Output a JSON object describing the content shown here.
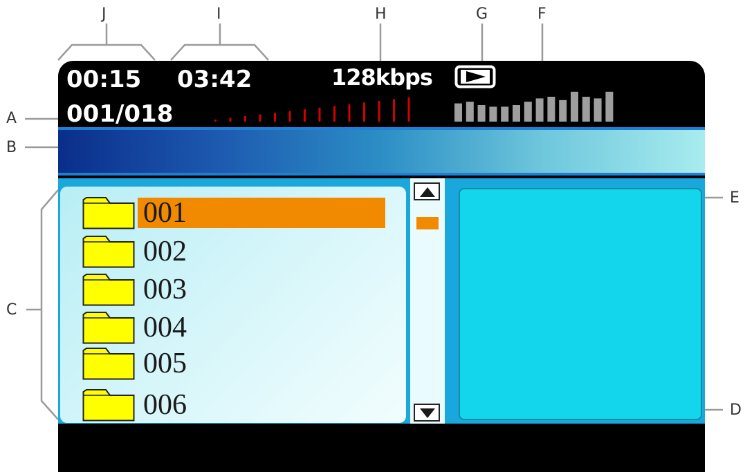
{
  "callouts": {
    "A": "A",
    "B": "B",
    "C": "C",
    "D": "D",
    "E": "E",
    "F": "F",
    "G": "G",
    "H": "H",
    "I": "I",
    "J": "J"
  },
  "status": {
    "elapsed_time": "00:15",
    "total_time": "03:42",
    "bitrate": "128kbps",
    "track_counter": "001/018",
    "play_state_icon": "play-icon",
    "volume_segments": 14,
    "equalizer_levels": [
      0.55,
      0.6,
      0.5,
      0.45,
      0.45,
      0.5,
      0.6,
      0.7,
      0.75,
      0.65,
      0.9,
      0.75,
      0.7,
      0.9
    ]
  },
  "folders": [
    {
      "label": "001",
      "selected": true
    },
    {
      "label": "002",
      "selected": false
    },
    {
      "label": "003",
      "selected": false
    },
    {
      "label": "004",
      "selected": false
    },
    {
      "label": "005",
      "selected": false
    },
    {
      "label": "006",
      "selected": false
    }
  ],
  "colors": {
    "selection": "#f28a00",
    "folder": "#ffff00",
    "volume": "#d40000",
    "equalizer": "#9e9e9e",
    "preview": "#13d6ec",
    "list_background": "#1aa7dc"
  }
}
